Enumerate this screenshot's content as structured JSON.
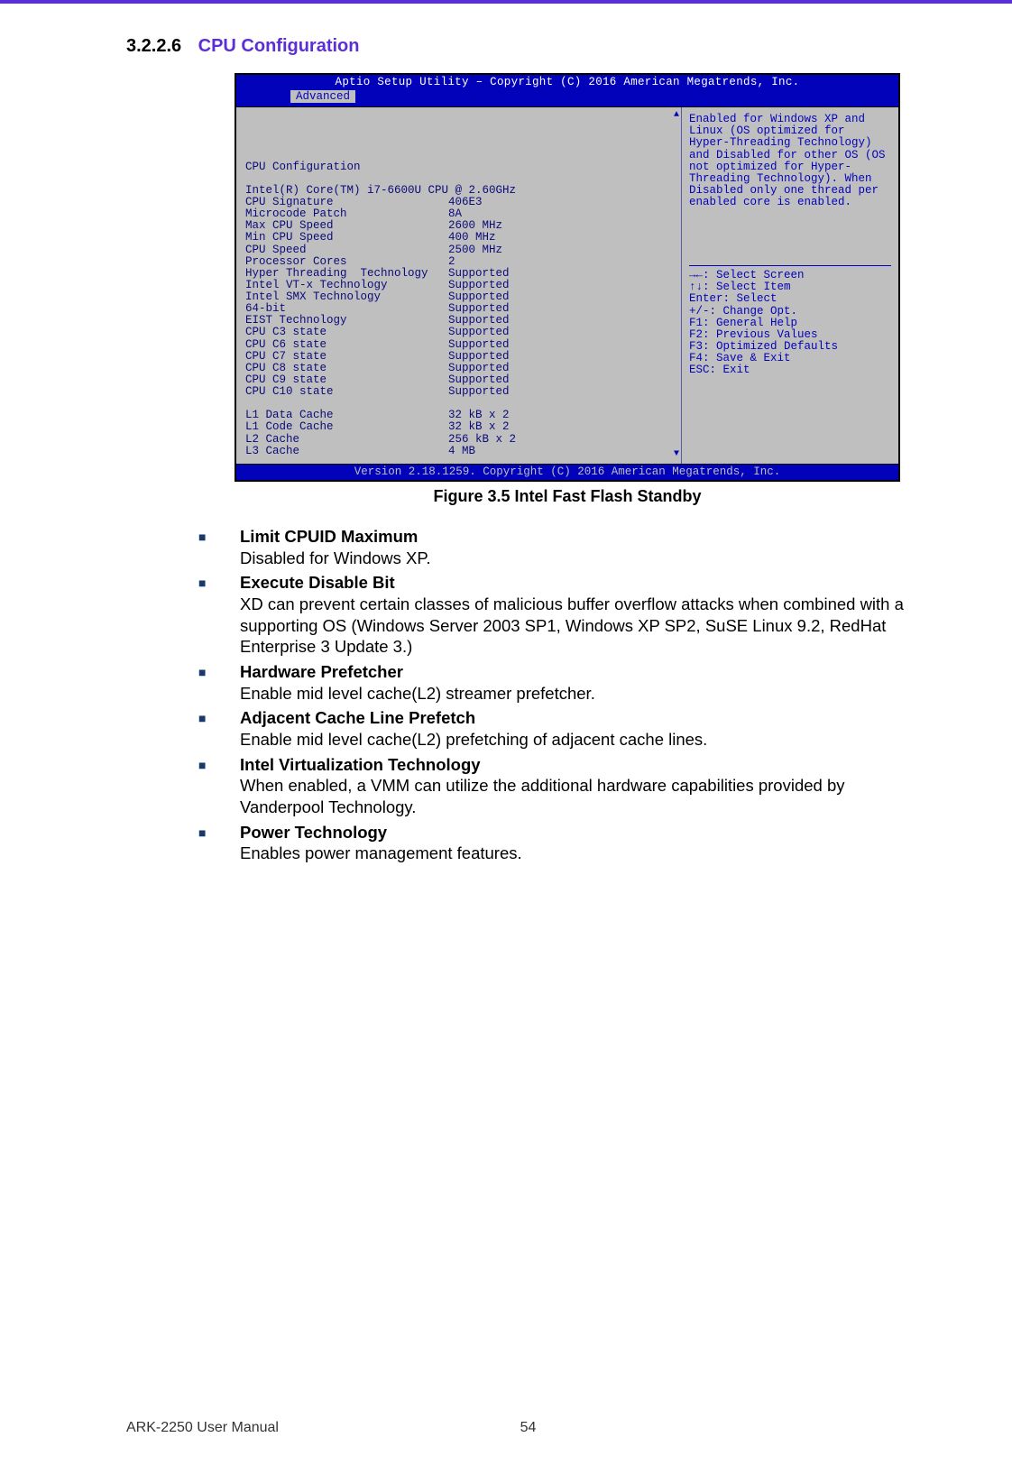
{
  "section": {
    "number": "3.2.2.6",
    "title": "CPU Configuration"
  },
  "bios": {
    "titlebar": "Aptio Setup Utility – Copyright (C) 2016 American Megatrends, Inc.",
    "tab": "Advanced",
    "footer": "Version 2.18.1259. Copyright (C) 2016 American Megatrends, Inc.",
    "left_heading": "CPU Configuration",
    "left_cpu_name": "Intel(R) Core(TM) i7-6600U CPU @ 2.60GHz",
    "rows": [
      {
        "label": "CPU Signature",
        "value": "406E3"
      },
      {
        "label": "Microcode Patch",
        "value": "8A"
      },
      {
        "label": "Max CPU Speed",
        "value": "2600 MHz"
      },
      {
        "label": "Min CPU Speed",
        "value": "400 MHz"
      },
      {
        "label": "CPU Speed",
        "value": "2500 MHz"
      },
      {
        "label": "Processor Cores",
        "value": "2"
      },
      {
        "label": "Hyper Threading  Technology",
        "value": "Supported"
      },
      {
        "label": "Intel VT-x Technology",
        "value": "Supported"
      },
      {
        "label": "Intel SMX Technology",
        "value": "Supported"
      },
      {
        "label": "64-bit",
        "value": "Supported"
      },
      {
        "label": "EIST Technology",
        "value": "Supported"
      },
      {
        "label": "CPU C3 state",
        "value": "Supported"
      },
      {
        "label": "CPU C6 state",
        "value": "Supported"
      },
      {
        "label": "CPU C7 state",
        "value": "Supported"
      },
      {
        "label": "CPU C8 state",
        "value": "Supported"
      },
      {
        "label": "CPU C9 state",
        "value": "Supported"
      },
      {
        "label": "CPU C10 state",
        "value": "Supported"
      }
    ],
    "cache_rows": [
      {
        "label": "L1 Data Cache",
        "value": "32 kB x 2"
      },
      {
        "label": "L1 Code Cache",
        "value": "32 kB x 2"
      },
      {
        "label": "L2 Cache",
        "value": "256 kB x 2"
      },
      {
        "label": "L3 Cache",
        "value": "4 MB"
      }
    ],
    "help_text": "Enabled for Windows XP and Linux (OS optimized for Hyper-Threading Technology) and Disabled for other OS (OS not optimized for Hyper-Threading Technology). When Disabled only one thread per enabled core is enabled.",
    "keys": [
      "→←: Select Screen",
      "↑↓: Select Item",
      "Enter: Select",
      "+/-: Change Opt.",
      "F1: General Help",
      "F2: Previous Values",
      "F3: Optimized Defaults",
      "F4: Save & Exit",
      "ESC: Exit"
    ]
  },
  "figure_caption": "Figure 3.5 Intel Fast Flash Standby",
  "options": [
    {
      "title": "Limit CPUID Maximum",
      "desc": "Disabled for Windows XP."
    },
    {
      "title": "Execute Disable Bit",
      "desc": "XD can prevent certain classes of malicious buffer overflow attacks when combined with a supporting OS (Windows Server 2003 SP1, Windows XP SP2, SuSE Linux 9.2, RedHat Enterprise 3 Update 3.)"
    },
    {
      "title": "Hardware Prefetcher",
      "desc": "Enable mid level cache(L2) streamer prefetcher."
    },
    {
      "title": "Adjacent Cache Line Prefetch",
      "desc": "Enable mid level cache(L2) prefetching of adjacent cache lines."
    },
    {
      "title": "Intel Virtualization Technology",
      "desc": "When enabled, a VMM can utilize the additional hardware capabilities provided by Vanderpool Technology."
    },
    {
      "title": "Power Technology",
      "desc": "Enables power management features."
    }
  ],
  "footer": {
    "doc": "ARK-2250 User Manual",
    "page": "54"
  }
}
